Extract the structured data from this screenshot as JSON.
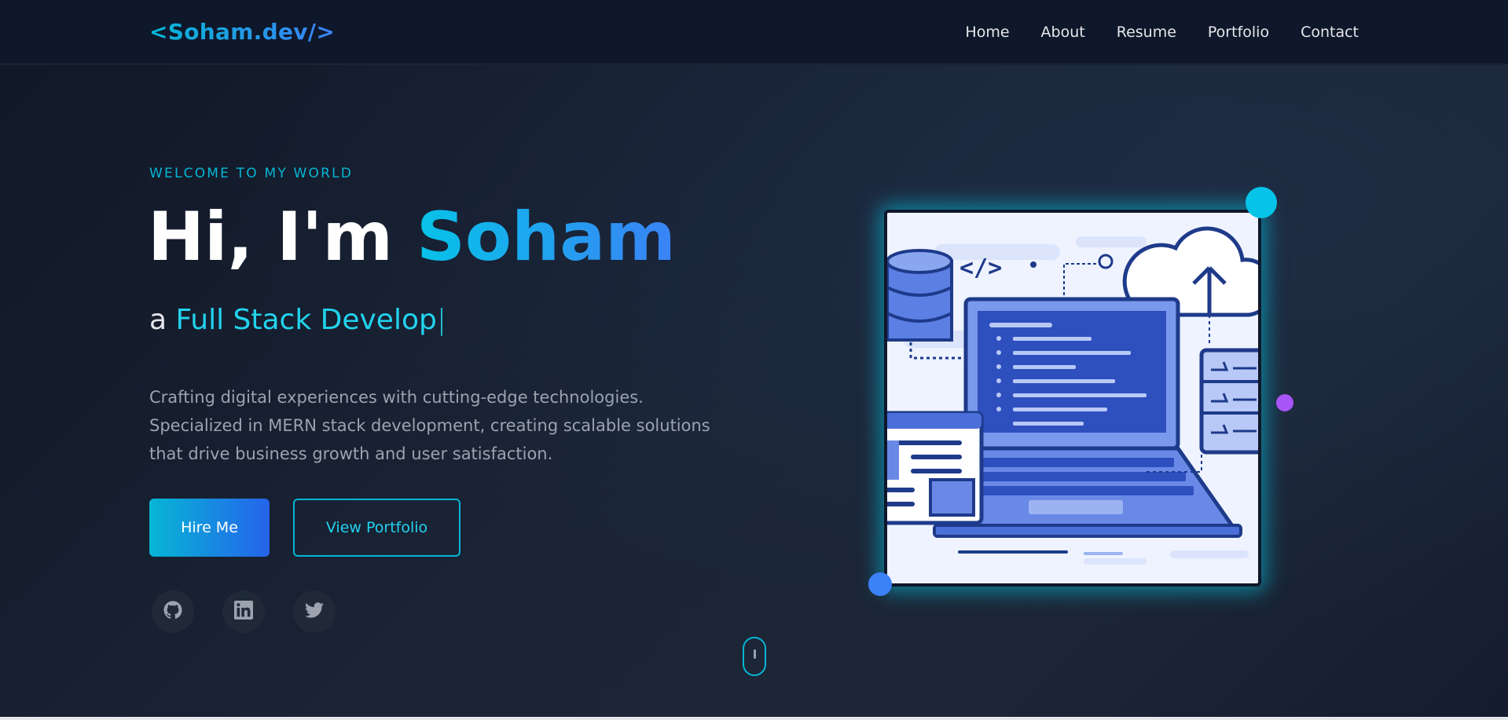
{
  "nav": {
    "logo": "<Soham.dev/>",
    "links": [
      "Home",
      "About",
      "Resume",
      "Portfolio",
      "Contact"
    ]
  },
  "hero": {
    "eyebrow": "WELCOME TO MY WORLD",
    "greeting": "Hi, I'm ",
    "name": "Soham",
    "sub_prefix": "a ",
    "role": "Full Stack Develop",
    "caret": "|",
    "description": "Crafting digital experiences with cutting-edge technologies. Specialized in MERN stack development, creating scalable solutions that drive business growth and user satisfaction.",
    "primary_button": "Hire Me",
    "secondary_button": "View Portfolio",
    "social": [
      "github-icon",
      "linkedin-icon",
      "twitter-icon"
    ]
  },
  "colors": {
    "accent_cyan": "#06b6d4",
    "accent_blue": "#3b82f6",
    "accent_purple": "#a855f7",
    "background": "#111827",
    "nav_background": "#0f172a"
  }
}
